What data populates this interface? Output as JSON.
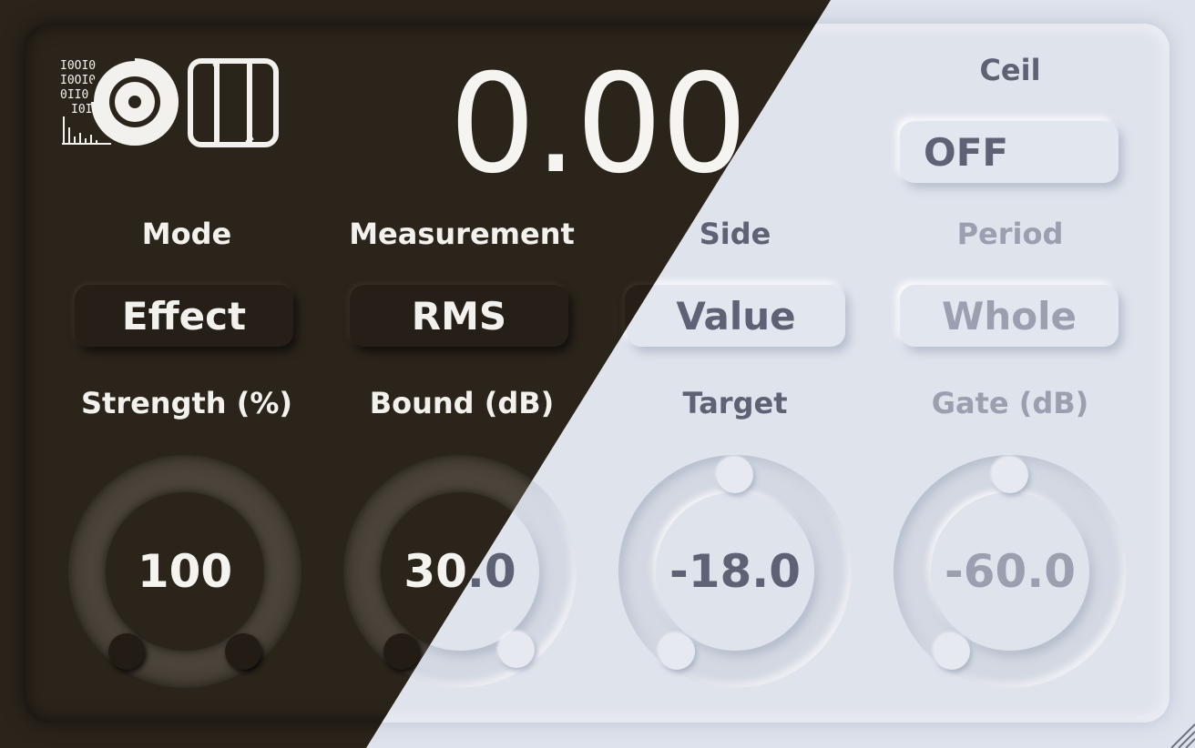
{
  "display": {
    "value": "0.00"
  },
  "ceil": {
    "label": "Ceil",
    "value": "OFF"
  },
  "mode": {
    "label": "Mode",
    "value": "Effect"
  },
  "measurement": {
    "label": "Measurement",
    "value": "RMS"
  },
  "side": {
    "label": "Side",
    "value": "Value"
  },
  "period": {
    "label": "Period",
    "value": "Whole"
  },
  "knobs": {
    "strength": {
      "label": "Strength (%)",
      "value": "100"
    },
    "bound": {
      "label": "Bound (dB)",
      "value": "30.0"
    },
    "target": {
      "label": "Target",
      "value": "-18.0"
    },
    "gate": {
      "label": "Gate (dB)",
      "value": "-60.0"
    }
  },
  "icons": {
    "logo": "disc-binary-logo-icon",
    "split": "split-view-icon",
    "resize": "resize-grip-icon"
  },
  "colors": {
    "dark_bg": "#2b241b",
    "light_bg": "#dfe3ec",
    "dark_text": "#f3f1ee",
    "light_text": "#5d6375",
    "light_muted": "#9aa0b0"
  }
}
